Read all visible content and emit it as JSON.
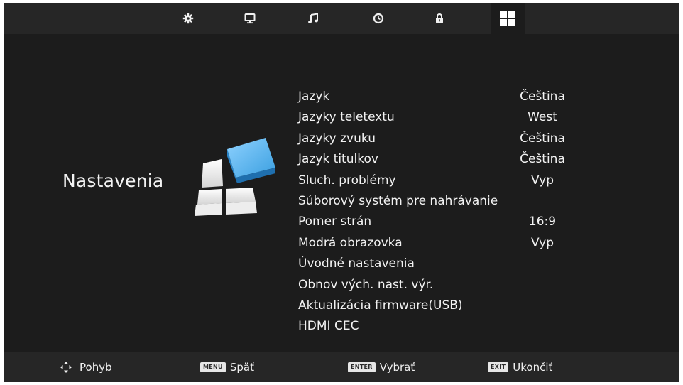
{
  "top_tabs": [
    {
      "icon": "gear-icon"
    },
    {
      "icon": "monitor-icon"
    },
    {
      "icon": "music-note-icon"
    },
    {
      "icon": "clock-icon"
    },
    {
      "icon": "lock-icon"
    },
    {
      "icon": "grid-icon",
      "active": true
    }
  ],
  "page": {
    "title": "Nastavenia"
  },
  "menu": {
    "items": [
      {
        "label": "Jazyk",
        "value": "Čeština"
      },
      {
        "label": "Jazyky teletextu",
        "value": "West"
      },
      {
        "label": "Jazyky zvuku",
        "value": "Čeština"
      },
      {
        "label": "Jazyk titulkov",
        "value": "Čeština"
      },
      {
        "label": "Sluch. problémy",
        "value": "Vyp"
      },
      {
        "label": "Súborový systém pre nahrávanie",
        "value": ""
      },
      {
        "label": "Pomer strán",
        "value": "16:9"
      },
      {
        "label": "Modrá obrazovka",
        "value": "Vyp"
      },
      {
        "label": "Úvodné nastavenia",
        "value": ""
      },
      {
        "label": "Obnov vých. nast. výr.",
        "value": ""
      },
      {
        "label": "Aktualizácia firmware(USB)",
        "value": ""
      },
      {
        "label": "HDMI CEC",
        "value": ""
      }
    ]
  },
  "hints": {
    "move": {
      "icon": "navigation-arrows-icon",
      "label": "Pohyb"
    },
    "back": {
      "key": "MENU",
      "label": "Späť"
    },
    "select": {
      "key": "ENTER",
      "label": "Vybrať"
    },
    "exit": {
      "key": "EXIT",
      "label": "Ukončiť"
    }
  },
  "colors": {
    "background": "#1c1c1c",
    "bar": "#262626",
    "text": "#f2f2f2",
    "logo_blue": "#3a9fe0"
  }
}
